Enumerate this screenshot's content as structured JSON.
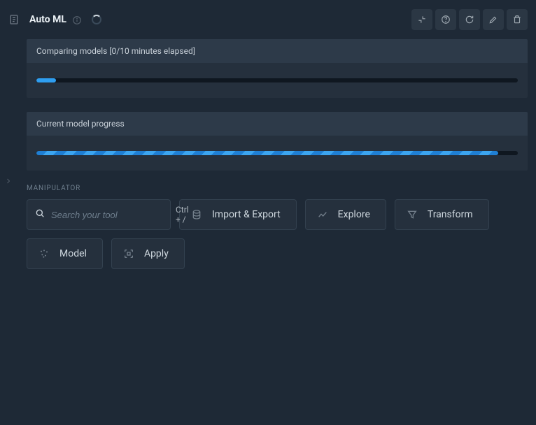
{
  "header": {
    "title": "Auto ML"
  },
  "progress": {
    "comparing": {
      "label": "Comparing models [0/10 minutes elapsed]",
      "percent": 4
    },
    "current": {
      "label": "Current model progress",
      "percent": 96
    }
  },
  "manipulator": {
    "section_label": "MANIPULATOR",
    "search": {
      "placeholder": "Search your tool",
      "shortcut": "Ctrl + /"
    },
    "tools": {
      "import_export": "Import & Export",
      "explore": "Explore",
      "transform": "Transform",
      "model": "Model",
      "apply": "Apply"
    }
  }
}
